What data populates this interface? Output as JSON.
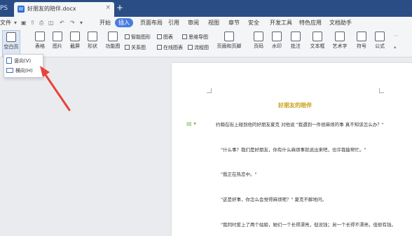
{
  "tabs": {
    "left_label": "PS",
    "doc_name": "好朋友的陪伴.docx",
    "close": "×",
    "new_tab": "+"
  },
  "menu": {
    "file": "文件",
    "items": [
      "开始",
      "插入",
      "页面布局",
      "引用",
      "审阅",
      "视图",
      "章节",
      "安全",
      "开发工具",
      "特色应用",
      "文档助手"
    ]
  },
  "toolbar": {
    "buttons": [
      "空白页",
      "表格",
      "图片",
      "截屏",
      "形状",
      "功能图",
      "页眉和页脚",
      "页码",
      "水印",
      "批注",
      "文本框",
      "艺术字",
      "符号",
      "公式"
    ],
    "small": {
      "smart_graphic": "智能图形",
      "chart": "图表",
      "mind_map": "思维导图",
      "relation_map": "关系图",
      "online_chart": "在线图表",
      "flowchart": "流程图"
    }
  },
  "dropdown": {
    "items": [
      "竖向(V)",
      "横向(H)"
    ]
  },
  "document": {
    "title": "好朋友的陪伴",
    "paragraphs": [
      "约翰在街上碰到他的好朋友夏克 对他说 \"我遇到一件很麻烦的事 真不知该怎么办？\"",
      "\"什么事？我们是好朋友，你有什么麻烦事就说出来吧，也许我能帮忙。\"",
      "\"我正在热恋中。\"",
      "\"这是好事，你怎么会觉得麻烦呢？\" 夏克不解地问。",
      "\"我同时爱上了两个姑娘，她们一个长得漂亮，但没钱；另一个长得不漂亮，但很有钱。"
    ]
  }
}
